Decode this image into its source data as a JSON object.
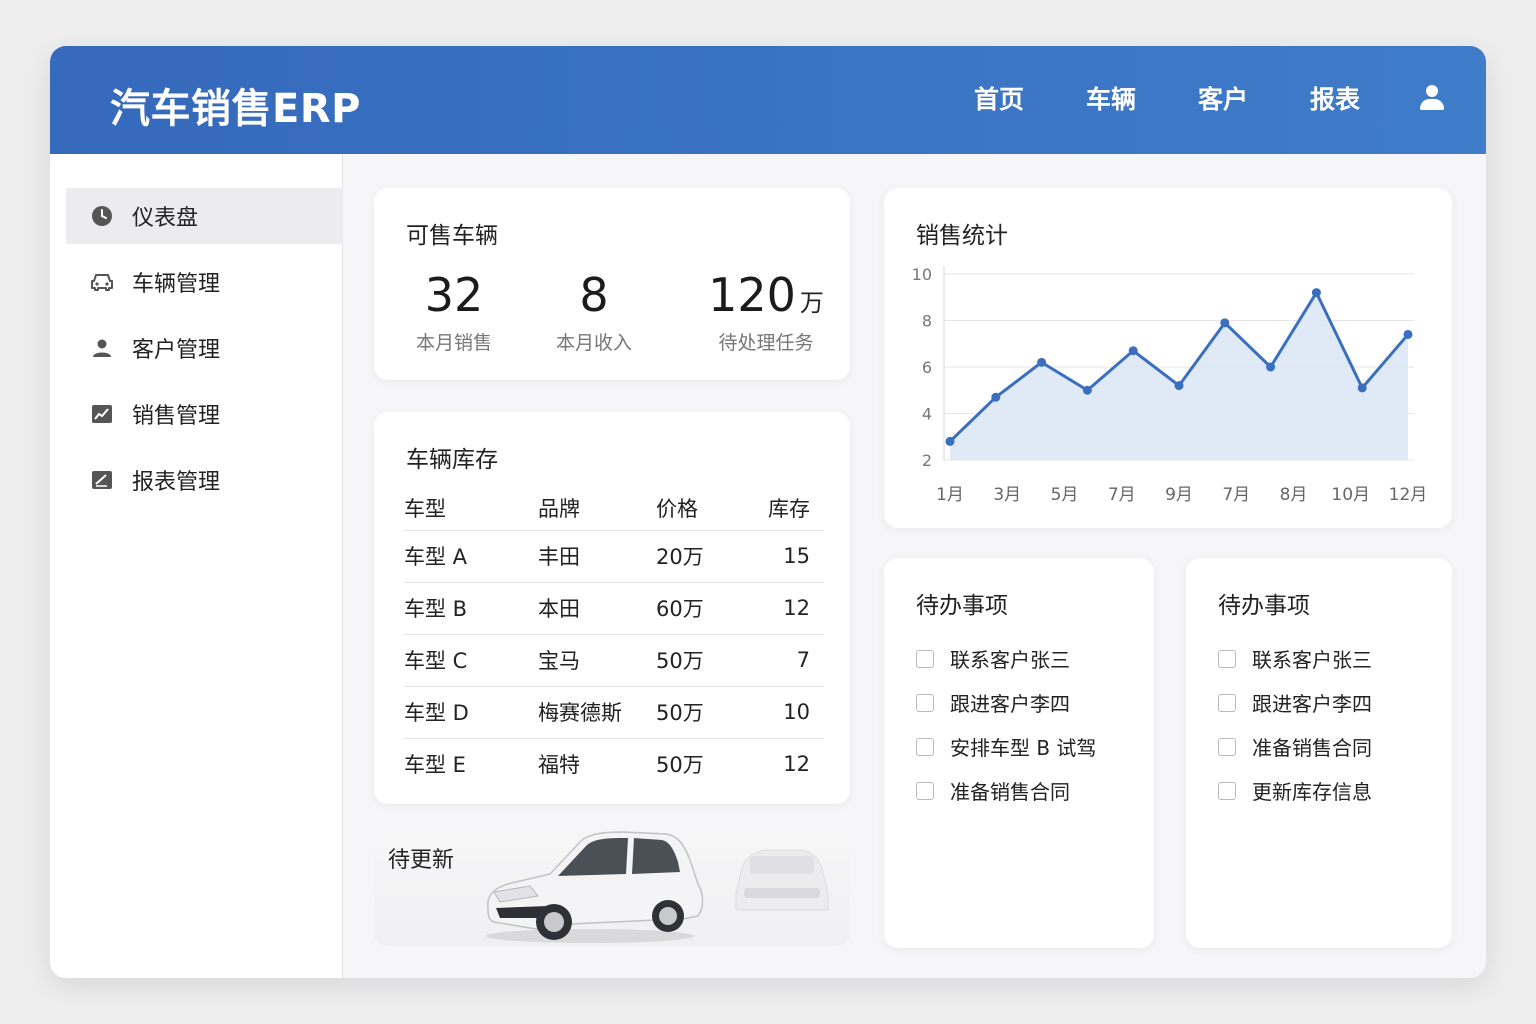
{
  "app": {
    "title": "汽车销售ERP"
  },
  "nav": {
    "items": [
      "首页",
      "车辆",
      "客户",
      "报表"
    ],
    "user_icon": "user-icon"
  },
  "sidebar": {
    "items": [
      {
        "label": "仪表盘",
        "icon": "clock-icon",
        "active": true
      },
      {
        "label": "车辆管理",
        "icon": "car-icon"
      },
      {
        "label": "客户管理",
        "icon": "person-icon"
      },
      {
        "label": "销售管理",
        "icon": "chart-icon"
      },
      {
        "label": "报表管理",
        "icon": "report-icon"
      }
    ]
  },
  "stats": {
    "title": "可售车辆",
    "items": [
      {
        "value": "32",
        "unit": "",
        "label": "本月销售"
      },
      {
        "value": "8",
        "unit": "",
        "label": "本月收入"
      },
      {
        "value": "120",
        "unit": "万",
        "label": "待处理任务"
      }
    ]
  },
  "inventory": {
    "title": "车辆库存",
    "columns": [
      "车型",
      "品牌",
      "价格",
      "库存"
    ],
    "rows": [
      [
        "车型 A",
        "丰田",
        "20万",
        "15"
      ],
      [
        "车型 B",
        "本田",
        "60万",
        "12"
      ],
      [
        "车型 C",
        "宝马",
        "50万",
        "7"
      ],
      [
        "车型 D",
        "梅赛德斯",
        "50万",
        "10"
      ],
      [
        "车型 E",
        "福特",
        "50万",
        "12"
      ]
    ]
  },
  "promo": {
    "label": "待更新"
  },
  "sales_chart": {
    "title": "销售统计",
    "chart_data": {
      "type": "area",
      "x": [
        "1月",
        "3月",
        "5月",
        "7月",
        "9月",
        "7月",
        "8月",
        "10月",
        "12月"
      ],
      "y_ticks": [
        2,
        4,
        6,
        8,
        10
      ],
      "ylim": [
        2,
        10
      ],
      "values": [
        2.8,
        4.7,
        6.2,
        5.0,
        6.7,
        5.2,
        7.9,
        6.0,
        9.2,
        5.1,
        7.4
      ],
      "grid": true,
      "color": "#3a6fbf",
      "fill": "#dbe6f4"
    }
  },
  "todo_left": {
    "title": "待办事项",
    "items": [
      "联系客户张三",
      "跟进客户李四",
      "安排车型 B 试驾",
      "准备销售合同"
    ]
  },
  "todo_right": {
    "title": "待办事项",
    "items": [
      "联系客户张三",
      "跟进客户李四",
      "准备销售合同",
      "更新库存信息"
    ]
  },
  "colors": {
    "header": "#3a6fbf",
    "accent": "#3a6fbf",
    "background": "#eeeeef"
  }
}
